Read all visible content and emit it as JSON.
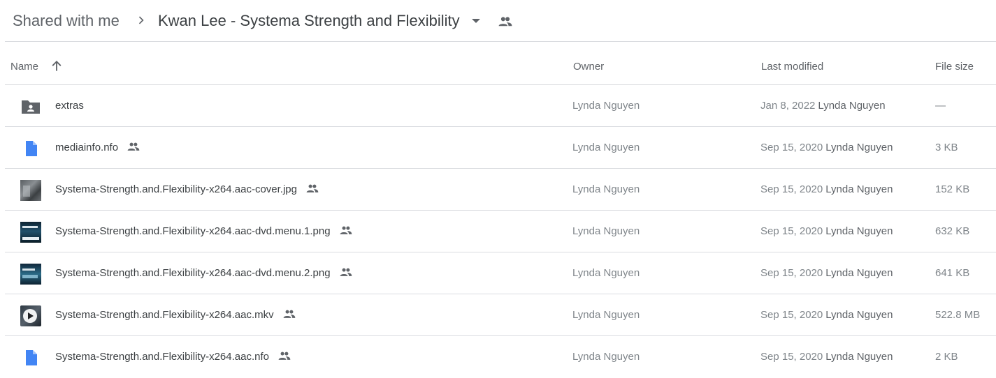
{
  "breadcrumb": {
    "root": "Shared with me",
    "current": "Kwan Lee - Systema Strength and Flexibility"
  },
  "columns": {
    "name": "Name",
    "owner": "Owner",
    "last_modified": "Last modified",
    "file_size": "File size"
  },
  "sort": {
    "column": "Name",
    "direction": "ascending"
  },
  "colors": {
    "doc_blue": "#4285f4",
    "folder_gray": "#5f6368",
    "divider": "#dadce0"
  },
  "rows": [
    {
      "name": "extras",
      "type": "shared-folder",
      "owner": "Lynda Nguyen",
      "modified_date": "Jan 8, 2022",
      "modified_by": "Lynda Nguyen",
      "size": "—",
      "shared": false
    },
    {
      "name": "mediainfo.nfo",
      "type": "document",
      "owner": "Lynda Nguyen",
      "modified_date": "Sep 15, 2020",
      "modified_by": "Lynda Nguyen",
      "size": "3 KB",
      "shared": true
    },
    {
      "name": "Systema-Strength.and.Flexibility-x264.aac-cover.jpg",
      "type": "image",
      "owner": "Lynda Nguyen",
      "modified_date": "Sep 15, 2020",
      "modified_by": "Lynda Nguyen",
      "size": "152 KB",
      "shared": true
    },
    {
      "name": "Systema-Strength.and.Flexibility-x264.aac-dvd.menu.1.png",
      "type": "image",
      "owner": "Lynda Nguyen",
      "modified_date": "Sep 15, 2020",
      "modified_by": "Lynda Nguyen",
      "size": "632 KB",
      "shared": true
    },
    {
      "name": "Systema-Strength.and.Flexibility-x264.aac-dvd.menu.2.png",
      "type": "image",
      "owner": "Lynda Nguyen",
      "modified_date": "Sep 15, 2020",
      "modified_by": "Lynda Nguyen",
      "size": "641 KB",
      "shared": true
    },
    {
      "name": "Systema-Strength.and.Flexibility-x264.aac.mkv",
      "type": "video",
      "owner": "Lynda Nguyen",
      "modified_date": "Sep 15, 2020",
      "modified_by": "Lynda Nguyen",
      "size": "522.8 MB",
      "shared": true
    },
    {
      "name": "Systema-Strength.and.Flexibility-x264.aac.nfo",
      "type": "document",
      "owner": "Lynda Nguyen",
      "modified_date": "Sep 15, 2020",
      "modified_by": "Lynda Nguyen",
      "size": "2 KB",
      "shared": true
    }
  ]
}
